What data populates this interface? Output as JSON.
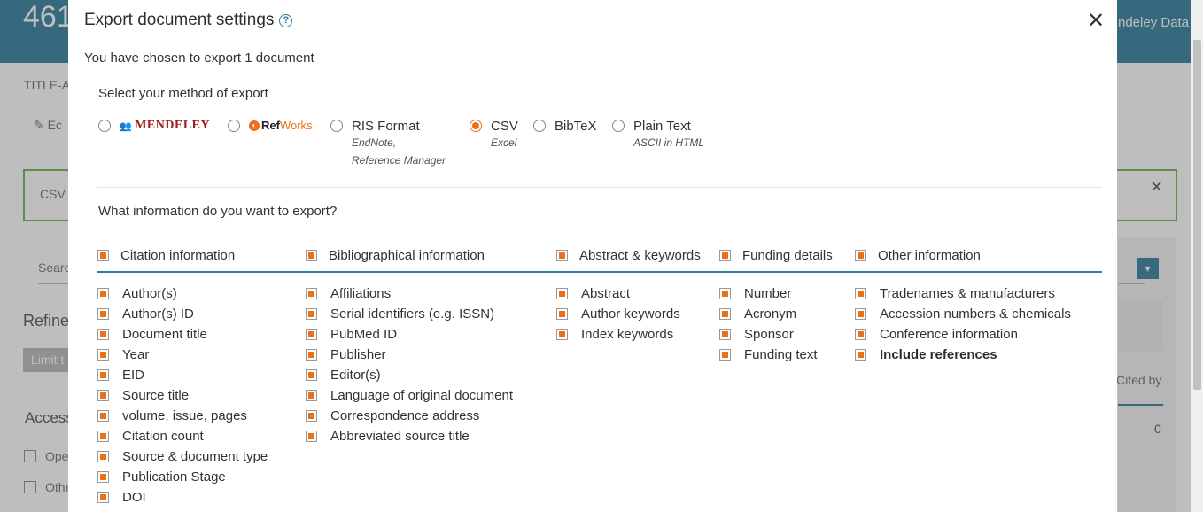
{
  "background": {
    "count_text": "461",
    "header_link": "ndeley Data",
    "title_abbr": "TITLE-A",
    "edit_text": "Ec",
    "alert_text": "CSV",
    "search_text": "Searc",
    "refine_text": "Refine",
    "limit_text": "Limit t",
    "access_text": "Access",
    "access_options": [
      "Ope",
      "Othe"
    ],
    "cited_by": "Cited by",
    "cited_count": "0"
  },
  "modal": {
    "title": "Export document settings",
    "help_icon": "?",
    "close_icon": "✕",
    "chosen_text": "You have chosen to export 1 document",
    "method_label": "Select your method of export",
    "methods": [
      {
        "id": "mendeley",
        "label": "MENDELEY",
        "selected": false
      },
      {
        "id": "refworks",
        "label_ref": "Ref",
        "label_works": "Works",
        "selected": false
      },
      {
        "id": "ris",
        "label": "RIS Format",
        "sub1": "EndNote,",
        "sub2": "Reference Manager",
        "selected": false
      },
      {
        "id": "csv",
        "label": "CSV",
        "sub1": "Excel",
        "selected": true
      },
      {
        "id": "bibtex",
        "label": "BibTeX",
        "selected": false
      },
      {
        "id": "plain",
        "label": "Plain Text",
        "sub1": "ASCII in HTML",
        "selected": false
      }
    ],
    "info_label": "What information do you want to export?",
    "groups": [
      {
        "title": "Citation information",
        "items": [
          "Author(s)",
          "Author(s) ID",
          "Document title",
          "Year",
          "EID",
          "Source title",
          "volume, issue, pages",
          "Citation count",
          "Source & document type",
          "Publication Stage",
          "DOI"
        ]
      },
      {
        "title": "Bibliographical information",
        "items": [
          "Affiliations",
          "Serial identifiers (e.g. ISSN)",
          "PubMed ID",
          "Publisher",
          "Editor(s)",
          "Language of original document",
          "Correspondence address",
          "Abbreviated source title"
        ]
      },
      {
        "title": "Abstract & keywords",
        "items": [
          "Abstract",
          "Author keywords",
          "Index keywords"
        ]
      },
      {
        "title": "Funding details",
        "items": [
          "Number",
          "Acronym",
          "Sponsor",
          "Funding text"
        ]
      },
      {
        "title": "Other information",
        "items": [
          "Tradenames & manufacturers",
          "Accession numbers & chemicals",
          "Conference information",
          "Include references"
        ]
      }
    ]
  },
  "colors": {
    "accent": "#e9711c",
    "brand": "#2e7d9c",
    "alert_border": "#6cb74d"
  }
}
